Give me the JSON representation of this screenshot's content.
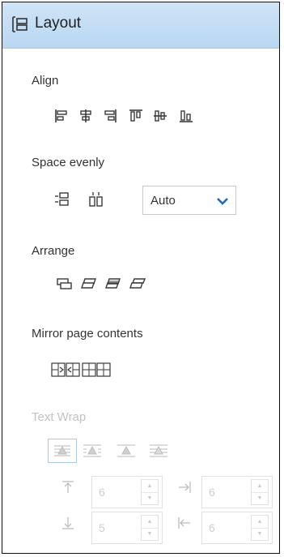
{
  "panel": {
    "title": "Layout",
    "title_icon": "layout-icon",
    "accent_header": "#c5dff5"
  },
  "align": {
    "label": "Align",
    "buttons": [
      "align-left-icon",
      "align-center-icon",
      "align-right-icon",
      "align-top-icon",
      "align-middle-icon",
      "align-bottom-icon"
    ]
  },
  "space_evenly": {
    "label": "Space evenly",
    "buttons": [
      "space-vertical-icon",
      "space-horizontal-icon"
    ],
    "spacing_select": {
      "value": "Auto"
    }
  },
  "arrange": {
    "label": "Arrange",
    "buttons": [
      "bring-to-front-icon",
      "bring-forward-icon",
      "send-backward-icon",
      "send-to-back-icon"
    ]
  },
  "mirror": {
    "label": "Mirror page contents",
    "buttons": [
      "mirror-left-right-icon",
      "mirror-right-left-icon"
    ]
  },
  "text_wrap": {
    "label": "Text Wrap",
    "enabled": false,
    "buttons": [
      "wrap-none-icon",
      "wrap-around-icon",
      "wrap-top-bottom-icon",
      "wrap-through-icon"
    ],
    "offsets": {
      "top": "6",
      "right": "6",
      "bottom": "5",
      "left": "6"
    }
  }
}
